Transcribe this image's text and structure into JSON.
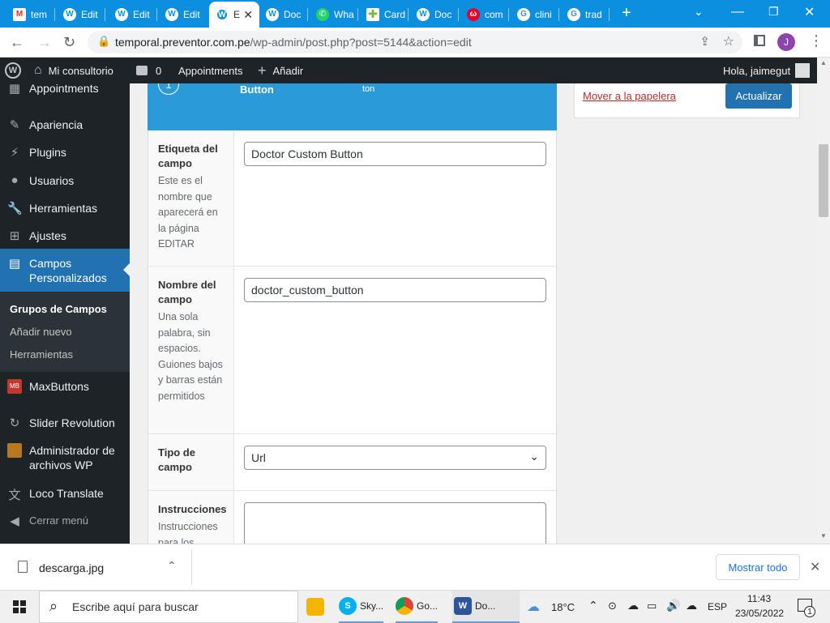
{
  "browser": {
    "tabs": [
      {
        "title": "tem",
        "icon": "gmail-icon"
      },
      {
        "title": "Edit",
        "icon": "wordpress-icon"
      },
      {
        "title": "Edit",
        "icon": "wordpress-icon"
      },
      {
        "title": "Edit",
        "icon": "wordpress-icon"
      },
      {
        "title": "E",
        "icon": "wordpress-icon",
        "active": true
      },
      {
        "title": "Doc",
        "icon": "wordpress-icon"
      },
      {
        "title": "Wha",
        "icon": "whatsapp-icon"
      },
      {
        "title": "Card",
        "icon": "plus-cross-icon"
      },
      {
        "title": "Doc",
        "icon": "wordpress-icon"
      },
      {
        "title": "com",
        "icon": "wuolah-icon"
      },
      {
        "title": "clini",
        "icon": "google-icon"
      },
      {
        "title": "trad",
        "icon": "google-icon"
      }
    ],
    "url_host": "temporal.preventor.com.pe",
    "url_path": "/wp-admin/post.php?post=5144&action=edit",
    "profile_initial": "J",
    "colors": {
      "tabstrip": "#0d8fe0",
      "wp_dark": "#1d2327",
      "wp_blue": "#2271b1"
    }
  },
  "adminbar": {
    "site_name": "Mi consultorio",
    "comments_count": "0",
    "appointments": "Appointments",
    "add_new": "Añadir",
    "greeting": "Hola, jaimegut"
  },
  "sidebar": {
    "items": [
      {
        "label": "Appointments",
        "icon": "appointments-icon"
      },
      {
        "label": "Apariencia",
        "icon": "brush-icon"
      },
      {
        "label": "Plugins",
        "icon": "plugin-icon"
      },
      {
        "label": "Usuarios",
        "icon": "user-icon"
      },
      {
        "label": "Herramientas",
        "icon": "wrench-icon"
      },
      {
        "label": "Ajustes",
        "icon": "settings-icon"
      },
      {
        "label": "Campos Personalizados",
        "icon": "table-icon",
        "current": true
      },
      {
        "label": "MaxButtons",
        "icon": "maxbuttons-icon"
      },
      {
        "label": "Slider Revolution",
        "icon": "slider-icon"
      },
      {
        "label": "Administrador de archivos WP",
        "icon": "folder-icon"
      },
      {
        "label": "Loco Translate",
        "icon": "translate-icon"
      },
      {
        "label": "Cerrar menú",
        "icon": "collapse-icon"
      }
    ],
    "submenu": [
      "Grupos de Campos",
      "Añadir nuevo",
      "Herramientas"
    ]
  },
  "field_header": {
    "number": "1",
    "label": "Button",
    "type_fragment": "ton"
  },
  "fields": [
    {
      "label": "Etiqueta del campo",
      "desc": "Este es el nombre que aparecerá en la página EDITAR",
      "value": "Doctor Custom Button"
    },
    {
      "label": "Nombre del campo",
      "desc": "Una sola palabra, sin espacios. Guiones bajos y barras están permitidos",
      "value": "doctor_custom_button"
    },
    {
      "label": "Tipo de campo",
      "desc": "",
      "value": "Url"
    },
    {
      "label": "Instrucciones",
      "desc": "Instrucciones para los",
      "value": ""
    }
  ],
  "publish": {
    "trash": "Mover a la papelera",
    "update": "Actualizar"
  },
  "downloads": {
    "file": "descarga.jpg",
    "show_all": "Mostrar todo"
  },
  "taskbar": {
    "search_placeholder": "Escribe aquí para buscar",
    "apps": [
      {
        "label": "",
        "icon": "file-explorer-icon"
      },
      {
        "label": "Sky...",
        "icon": "skype-icon"
      },
      {
        "label": "Go...",
        "icon": "chrome-icon"
      },
      {
        "label": "Do...",
        "icon": "word-icon"
      }
    ],
    "temperature": "18°C",
    "language": "ESP",
    "time": "11:43",
    "date": "23/05/2022",
    "notifications": "1"
  }
}
